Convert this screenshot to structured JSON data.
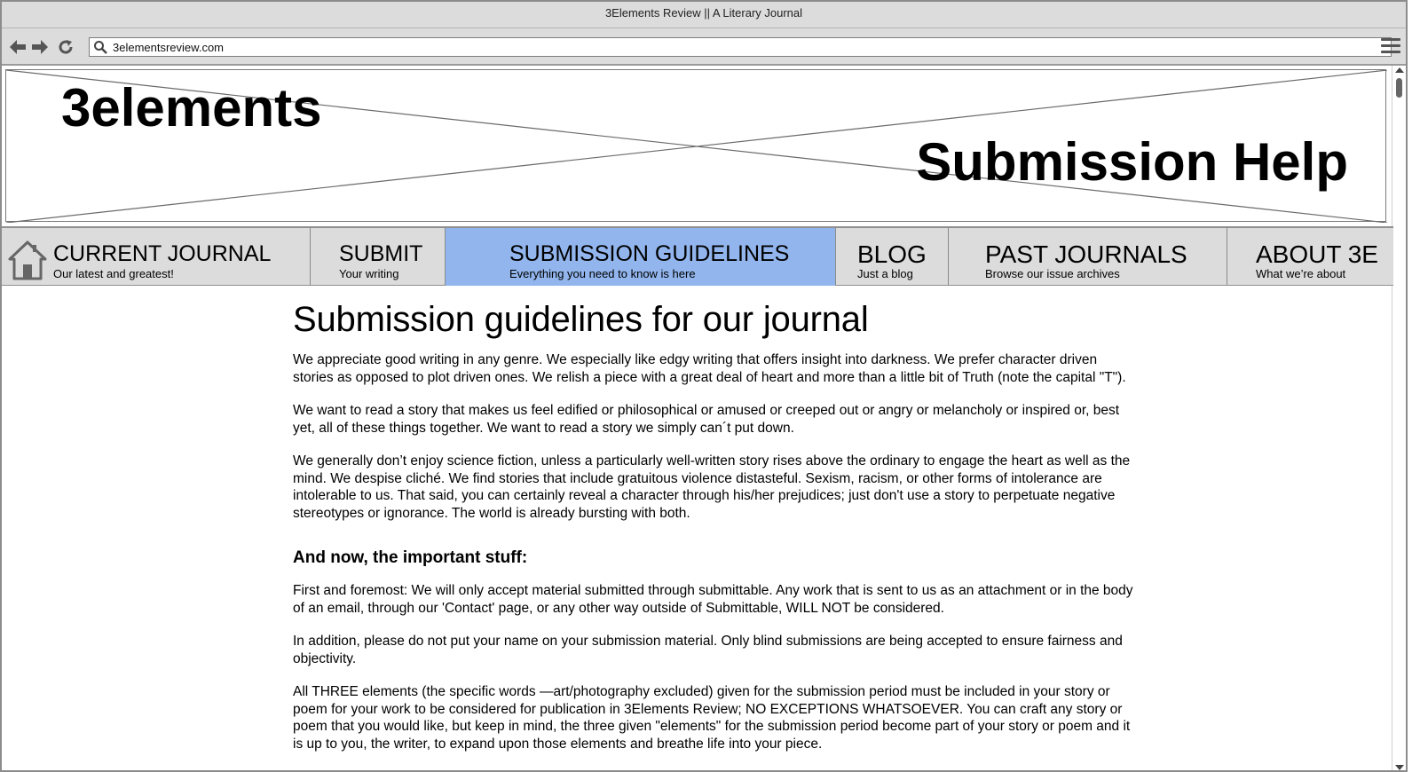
{
  "browser": {
    "window_title": "3Elements Review || A Literary Journal",
    "url": "3elementsreview.com"
  },
  "header": {
    "logo": "3elements",
    "title": "Submission Help"
  },
  "nav": {
    "items": [
      {
        "title": "CURRENT JOURNAL",
        "subtitle": "Our latest and greatest!"
      },
      {
        "title": "SUBMIT",
        "subtitle": "Your writing"
      },
      {
        "title": "SUBMISSION GUIDELINES",
        "subtitle": "Everything you need to know is here"
      },
      {
        "title": "BLOG",
        "subtitle": "Just a blog"
      },
      {
        "title": "PAST JOURNALS",
        "subtitle": "Browse our issue archives"
      },
      {
        "title": "ABOUT 3E",
        "subtitle": "What we’re about"
      }
    ],
    "active_color": "#91b5ec"
  },
  "main": {
    "heading": "Submission guidelines for our journal",
    "paragraphs": [
      "We appreciate good writing in any genre. We especially like edgy writing that offers insight into darkness. We prefer character driven stories as opposed to plot driven ones. We relish a piece with a great deal of heart  and more than a little bit of Truth (note the capital \"T\").",
      "We want to read a story  that makes us feel edified or philosophical or amused or creeped out or angry  or melancholy or inspired or, best yet, all of these things together. We want  to read a story we simply can´t put down.",
      "We generally don’t enjoy  science fiction, unless a particularly well-written story rises above the  ordinary to engage the heart as well as the mind. We despise cliché.  We find stories that include gratuitous violence distasteful. Sexism,  racism, or other forms of intolerance are intolerable to us. That said, you can  certainly reveal a character through his/her prejudices; just don't use a story  to perpetuate negative stereotypes or ignorance. The world is already bursting with both."
    ],
    "subheading": "And now, the important stuff:",
    "important_paragraphs": [
      "First and foremost: We will only accept material submitted through submittable. Any work that is sent to us as an attachment or in the body of an email, through our 'Contact' page, or any other way outside of Submittable, WILL NOT be considered.",
      "In addition, please do not put your name on your submission material. Only blind submissions are being accepted to ensure fairness and objectivity.",
      "All THREE elements (the specific words —art/photography excluded) given for the submission period must be included in your story or poem for your work to be considered for publication in 3Elements Review; NO EXCEPTIONS WHATSOEVER. You can craft any story or poem that you would like, but keep in mind, the three given \"elements\" for the submission period become part of your story or poem and it is up to you, the writer, to expand upon those elements and breathe life into your piece."
    ]
  },
  "icons": {
    "back": "arrow-left-icon",
    "forward": "arrow-right-icon",
    "reload": "reload-icon",
    "search": "search-icon",
    "menu": "hamburger-menu-icon",
    "home": "home-icon"
  }
}
